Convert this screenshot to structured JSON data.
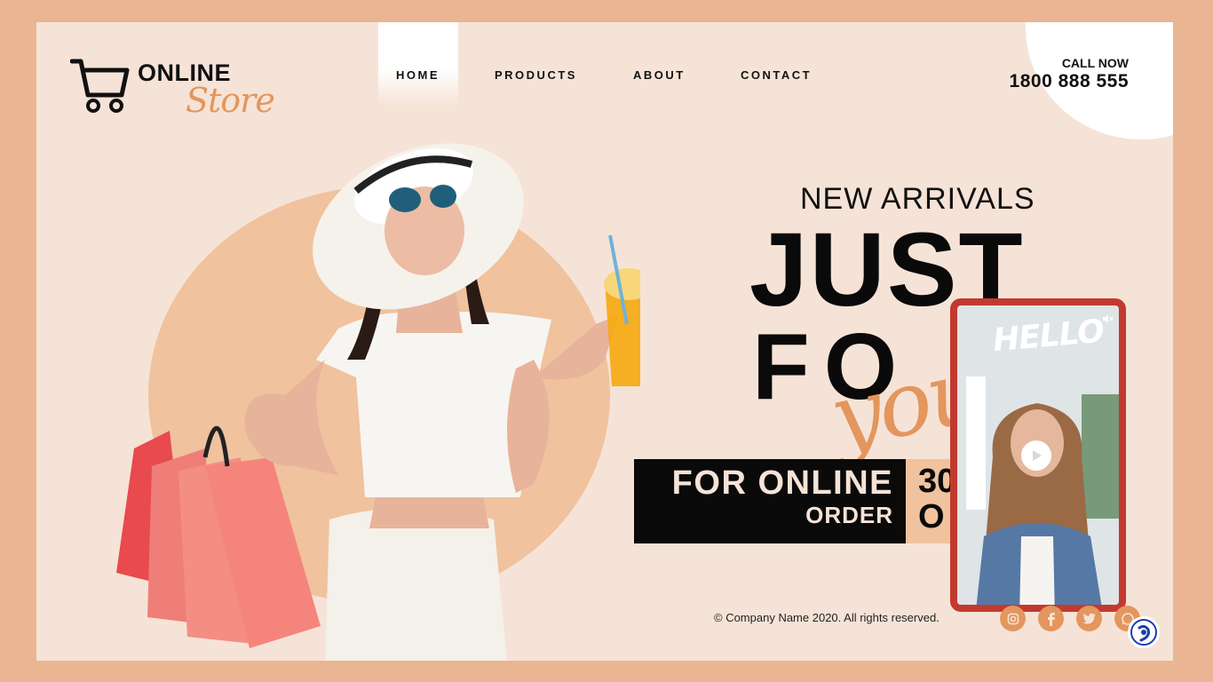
{
  "logo": {
    "line1": "ONLINE",
    "line2": "Store"
  },
  "nav": {
    "items": [
      {
        "label": "HOME"
      },
      {
        "label": "PRODUCTS"
      },
      {
        "label": "ABOUT"
      },
      {
        "label": "CONTACT"
      }
    ]
  },
  "call": {
    "label": "CALL NOW",
    "number": "1800 888 555"
  },
  "hero": {
    "kicker": "NEW ARRIVALS",
    "headline_1": "JUST",
    "headline_2": "FO",
    "script": "you",
    "promo_line1": "FOR ONLINE",
    "promo_line2": "ORDER",
    "pct_line1": "30",
    "pct_line2": "O"
  },
  "video": {
    "caption": "HELLO"
  },
  "footer": {
    "copyright": "© Company Name 2020. All rights reserved."
  },
  "social": [
    "instagram-icon",
    "facebook-icon",
    "twitter-icon",
    "whatsapp-icon"
  ],
  "colors": {
    "accent": "#e3965d",
    "bg": "#f6e3d7",
    "peach": "#f0c29e",
    "frame": "#c23a2f"
  }
}
